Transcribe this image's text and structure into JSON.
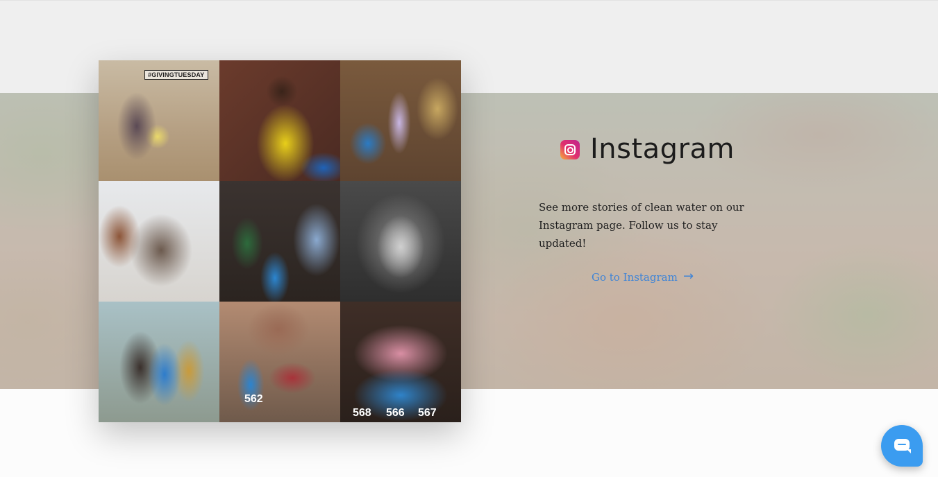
{
  "instagram": {
    "title": "Instagram",
    "description": "See more stories of clean water on our Instagram page. Follow us to stay updated!",
    "link_label": "Go to Instagram",
    "arrow": "→",
    "accent_color": "#3f84d6",
    "icon": "instagram-icon"
  },
  "gallery": {
    "photos": [
      {
        "tag": "#GIVINGTUESDAY"
      },
      {},
      {},
      {},
      {},
      {},
      {},
      {
        "numbers": [
          "562"
        ]
      },
      {
        "numbers": [
          "568",
          "566",
          "567"
        ]
      }
    ]
  },
  "chat": {
    "icon": "chat-bubble-icon",
    "color": "#3b9cf0"
  }
}
